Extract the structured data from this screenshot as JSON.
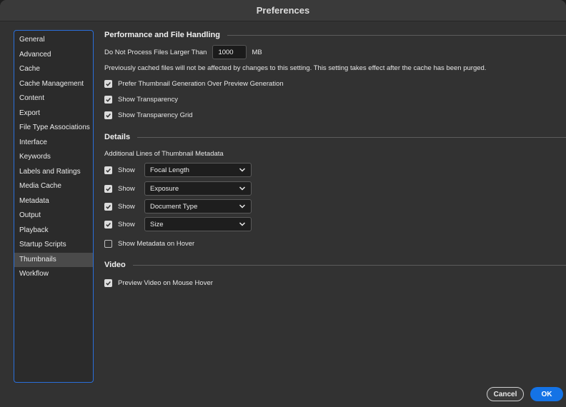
{
  "window": {
    "title": "Preferences"
  },
  "sidebar": {
    "items": [
      {
        "label": "General"
      },
      {
        "label": "Advanced"
      },
      {
        "label": "Cache"
      },
      {
        "label": "Cache Management"
      },
      {
        "label": "Content"
      },
      {
        "label": "Export"
      },
      {
        "label": "File Type Associations"
      },
      {
        "label": "Interface"
      },
      {
        "label": "Keywords"
      },
      {
        "label": "Labels and Ratings"
      },
      {
        "label": "Media Cache"
      },
      {
        "label": "Metadata"
      },
      {
        "label": "Output"
      },
      {
        "label": "Playback"
      },
      {
        "label": "Startup Scripts"
      },
      {
        "label": "Thumbnails",
        "selected": true
      },
      {
        "label": "Workflow"
      }
    ]
  },
  "performance": {
    "header": "Performance and File Handling",
    "max_size_label": "Do Not Process Files Larger Than",
    "max_size_value": "1000",
    "max_size_unit": "MB",
    "note": "Previously cached files will not be affected by changes to this setting. This setting takes effect after the cache has been purged.",
    "prefer_thumbnail": {
      "label": "Prefer Thumbnail Generation Over Preview Generation",
      "checked": true
    },
    "show_transparency": {
      "label": "Show Transparency",
      "checked": true
    },
    "show_transparency_grid": {
      "label": "Show Transparency Grid",
      "checked": true
    }
  },
  "details": {
    "header": "Details",
    "subheader": "Additional Lines of Thumbnail Metadata",
    "lines": [
      {
        "show_label": "Show",
        "checked": true,
        "value": "Focal Length"
      },
      {
        "show_label": "Show",
        "checked": true,
        "value": "Exposure"
      },
      {
        "show_label": "Show",
        "checked": true,
        "value": "Document Type"
      },
      {
        "show_label": "Show",
        "checked": true,
        "value": "Size"
      }
    ],
    "metadata_on_hover": {
      "label": "Show Metadata on Hover",
      "checked": false
    }
  },
  "video": {
    "header": "Video",
    "preview_on_hover": {
      "label": "Preview Video on Mouse Hover",
      "checked": true
    }
  },
  "buttons": {
    "cancel": "Cancel",
    "ok": "OK"
  },
  "colors": {
    "accent": "#1473e6",
    "sidebar_border": "#2a6fdb",
    "background": "#323232"
  }
}
